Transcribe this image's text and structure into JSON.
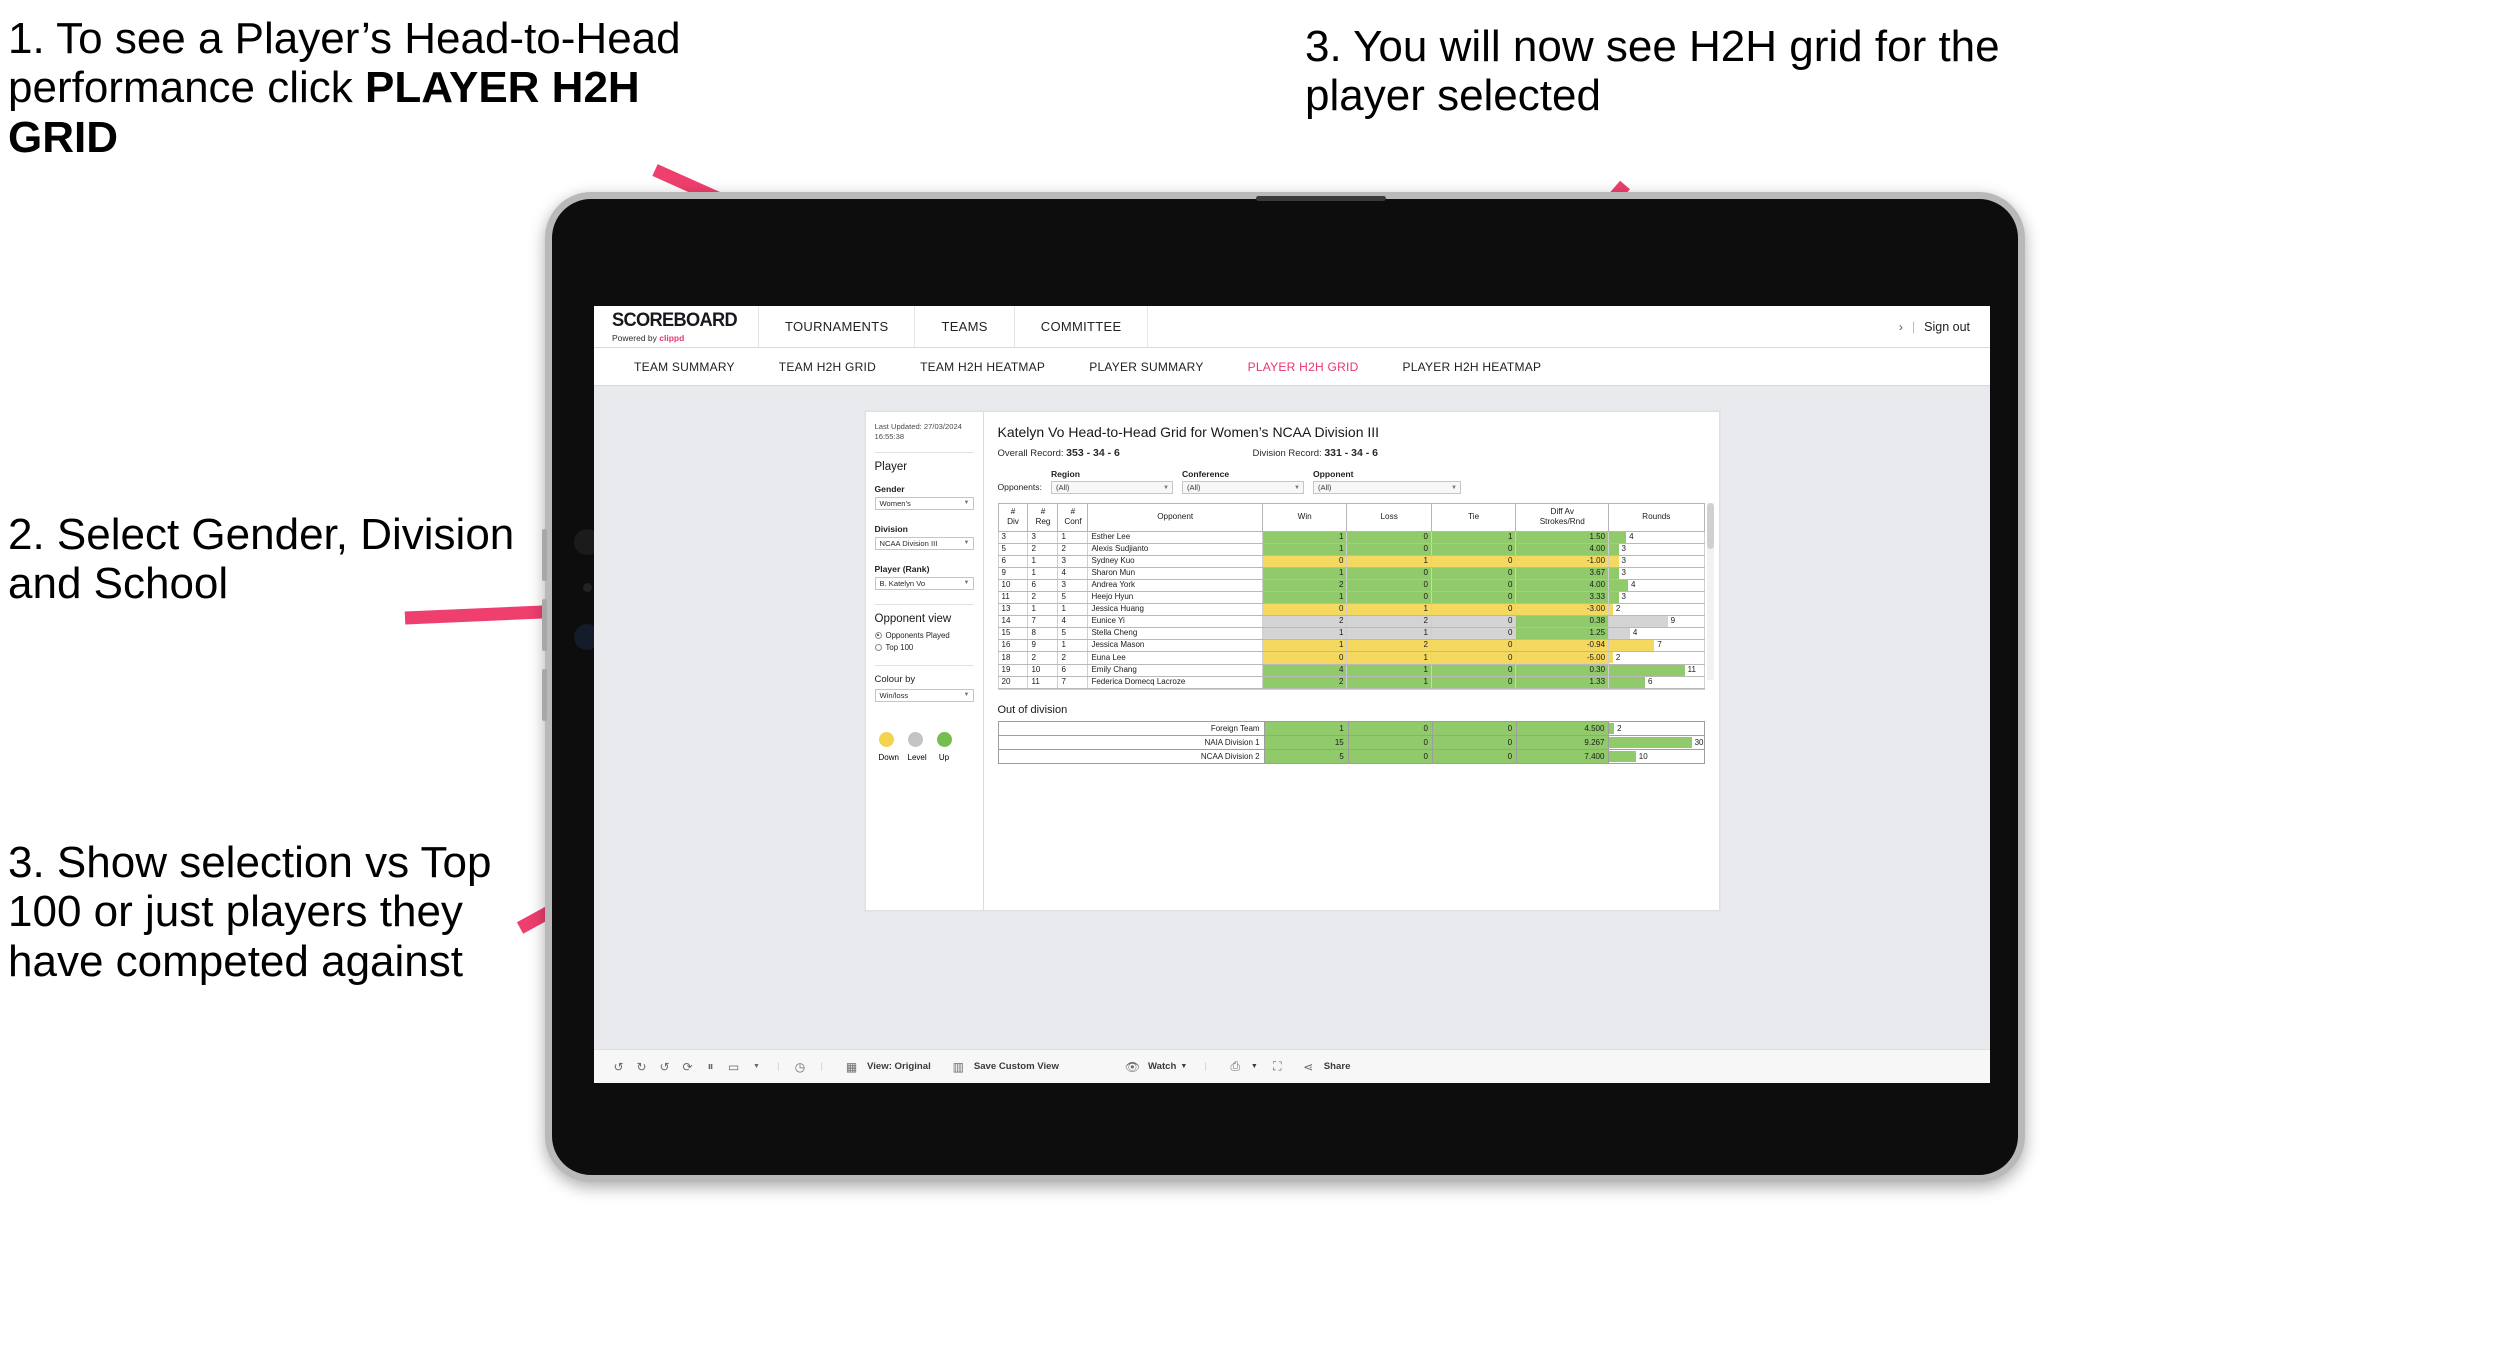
{
  "annotations": {
    "a1_prefix": "1. To see a Player’s Head-to-Head performance click ",
    "a1_bold": "PLAYER H2H GRID",
    "a2": "2. Select Gender, Division and School",
    "a3": "3. Show selection vs Top 100 or just players they have competed against",
    "a4": "3. You will now see H2H grid for the player selected",
    "arrow_color": "#ef3f6e"
  },
  "header": {
    "logo_main": "SCOREBOARD",
    "logo_sub_prefix": "Powered by ",
    "logo_sub_brand": "clippd",
    "menu": [
      "TOURNAMENTS",
      "TEAMS",
      "COMMITTEE"
    ],
    "chevron": "›",
    "separator": "|",
    "sign_out": "Sign out"
  },
  "subnav": {
    "items": [
      {
        "label": "TEAM SUMMARY",
        "active": false
      },
      {
        "label": "TEAM H2H GRID",
        "active": false
      },
      {
        "label": "TEAM H2H HEATMAP",
        "active": false
      },
      {
        "label": "PLAYER SUMMARY",
        "active": false
      },
      {
        "label": "PLAYER H2H GRID",
        "active": true
      },
      {
        "label": "PLAYER H2H HEATMAP",
        "active": false
      }
    ],
    "active_color": "#e8376b"
  },
  "sidebar": {
    "last_updated": "Last Updated: 27/03/2024 16:55:38",
    "player_heading": "Player",
    "gender_label": "Gender",
    "gender_value": "Women's",
    "division_label": "Division",
    "division_value": "NCAA Division III",
    "player_rank_label": "Player (Rank)",
    "player_rank_value": "B. Katelyn Vo",
    "opponent_view_heading": "Opponent view",
    "radio_options": [
      {
        "label": "Opponents Played",
        "selected": true
      },
      {
        "label": "Top 100",
        "selected": false
      }
    ],
    "colour_by_label": "Colour by",
    "colour_by_value": "Win/loss",
    "legend": [
      {
        "label": "Down",
        "color": "#f3d24f"
      },
      {
        "label": "Level",
        "color": "#c3c3c3"
      },
      {
        "label": "Up",
        "color": "#74bf4d"
      }
    ]
  },
  "main": {
    "title": "Katelyn Vo Head-to-Head Grid for Women’s NCAA Division III",
    "overall_record_label": "Overall Record: ",
    "overall_record_value": "353 -  34 - 6",
    "division_record_label": "Division Record: ",
    "division_record_value": "331 -  34 - 6",
    "opponents_label": "Opponents:",
    "filters": [
      {
        "label": "Region",
        "value": "(All)"
      },
      {
        "label": "Conference",
        "value": "(All)"
      },
      {
        "label": "Opponent",
        "value": "(All)"
      }
    ],
    "out_of_division_title": "Out of division"
  },
  "table": {
    "headers": [
      "#\nDiv",
      "#\nReg",
      "#\nConf",
      "Opponent",
      "Win",
      "Loss",
      "Tie",
      "Diff Av\nStrokes/Rnd",
      "Rounds"
    ],
    "header_lines": [
      [
        "#",
        "Div"
      ],
      [
        "#",
        "Reg"
      ],
      [
        "#",
        "Conf"
      ],
      [
        "Opponent"
      ],
      [
        "Win"
      ],
      [
        "Loss"
      ],
      [
        "Tie"
      ],
      [
        "Diff Av",
        "Strokes/Rnd"
      ],
      [
        "Rounds"
      ]
    ],
    "rows": [
      {
        "div": "3",
        "reg": "3",
        "conf": "1",
        "opponent": "Esther Lee",
        "win": "1",
        "loss": "0",
        "tie": "1",
        "diff": "1.50",
        "rounds": "4",
        "color": "g",
        "rounds_pct": 18
      },
      {
        "div": "5",
        "reg": "2",
        "conf": "2",
        "opponent": "Alexis Sudjianto",
        "win": "1",
        "loss": "0",
        "tie": "0",
        "diff": "4.00",
        "rounds": "3",
        "color": "g",
        "rounds_pct": 10
      },
      {
        "div": "6",
        "reg": "1",
        "conf": "3",
        "opponent": "Sydney Kuo",
        "win": "0",
        "loss": "1",
        "tie": "0",
        "diff": "-1.00",
        "rounds": "3",
        "color": "y",
        "rounds_pct": 10
      },
      {
        "div": "9",
        "reg": "1",
        "conf": "4",
        "opponent": "Sharon Mun",
        "win": "1",
        "loss": "0",
        "tie": "0",
        "diff": "3.67",
        "rounds": "3",
        "color": "g",
        "rounds_pct": 10
      },
      {
        "div": "10",
        "reg": "6",
        "conf": "3",
        "opponent": "Andrea York",
        "win": "2",
        "loss": "0",
        "tie": "0",
        "diff": "4.00",
        "rounds": "4",
        "color": "g",
        "rounds_pct": 20
      },
      {
        "div": "11",
        "reg": "2",
        "conf": "5",
        "opponent": "Heejo Hyun",
        "win": "1",
        "loss": "0",
        "tie": "0",
        "diff": "3.33",
        "rounds": "3",
        "color": "g",
        "rounds_pct": 10
      },
      {
        "div": "13",
        "reg": "1",
        "conf": "1",
        "opponent": "Jessica Huang",
        "win": "0",
        "loss": "1",
        "tie": "0",
        "diff": "-3.00",
        "rounds": "2",
        "color": "y",
        "rounds_pct": 4
      },
      {
        "div": "14",
        "reg": "7",
        "conf": "4",
        "opponent": "Eunice Yi",
        "win": "2",
        "loss": "2",
        "tie": "0",
        "diff": "0.38",
        "rounds": "9",
        "color": "gr",
        "diff_color": "g",
        "rounds_pct": 62
      },
      {
        "div": "15",
        "reg": "8",
        "conf": "5",
        "opponent": "Stella Cheng",
        "win": "1",
        "loss": "1",
        "tie": "0",
        "diff": "1.25",
        "rounds": "4",
        "color": "gr",
        "diff_color": "g",
        "rounds_pct": 22
      },
      {
        "div": "16",
        "reg": "9",
        "conf": "1",
        "opponent": "Jessica Mason",
        "win": "1",
        "loss": "2",
        "tie": "0",
        "diff": "-0.94",
        "rounds": "7",
        "color": "y",
        "rounds_pct": 48
      },
      {
        "div": "18",
        "reg": "2",
        "conf": "2",
        "opponent": "Euna Lee",
        "win": "0",
        "loss": "1",
        "tie": "0",
        "diff": "-5.00",
        "rounds": "2",
        "color": "y",
        "rounds_pct": 4
      },
      {
        "div": "19",
        "reg": "10",
        "conf": "6",
        "opponent": "Emily Chang",
        "win": "4",
        "loss": "1",
        "tie": "0",
        "diff": "0.30",
        "rounds": "11",
        "color": "g",
        "rounds_pct": 80
      },
      {
        "div": "20",
        "reg": "11",
        "conf": "7",
        "opponent": "Federica Domecq Lacroze",
        "win": "2",
        "loss": "1",
        "tie": "0",
        "diff": "1.33",
        "rounds": "6",
        "color": "g",
        "rounds_pct": 38
      }
    ]
  },
  "out_of_division": {
    "rows": [
      {
        "name": "Foreign Team",
        "win": "1",
        "loss": "0",
        "tie": "0",
        "diff": "4.500",
        "rounds": "2",
        "color": "g",
        "rounds_pct": 5
      },
      {
        "name": "NAIA Division 1",
        "win": "15",
        "loss": "0",
        "tie": "0",
        "diff": "9.267",
        "rounds": "30",
        "color": "g",
        "rounds_pct": 88
      },
      {
        "name": "NCAA Division 2",
        "win": "5",
        "loss": "0",
        "tie": "0",
        "diff": "7.400",
        "rounds": "10",
        "color": "g",
        "rounds_pct": 28
      }
    ]
  },
  "toolbar": {
    "undo_icon": "undo-icon",
    "redo_icon": "redo-icon",
    "revert_icon": "revert-icon",
    "refresh_icon": "refresh-data-icon",
    "pause_icon": "pause-updates-icon",
    "highlight_icon": "highlight-icon",
    "alert_icon": "alerts-icon",
    "view_label": "View: Original",
    "save_custom_view": "Save Custom View",
    "watch": "Watch",
    "download_icon": "download-icon",
    "fullscreen_icon": "fullscreen-icon",
    "share": "Share"
  }
}
